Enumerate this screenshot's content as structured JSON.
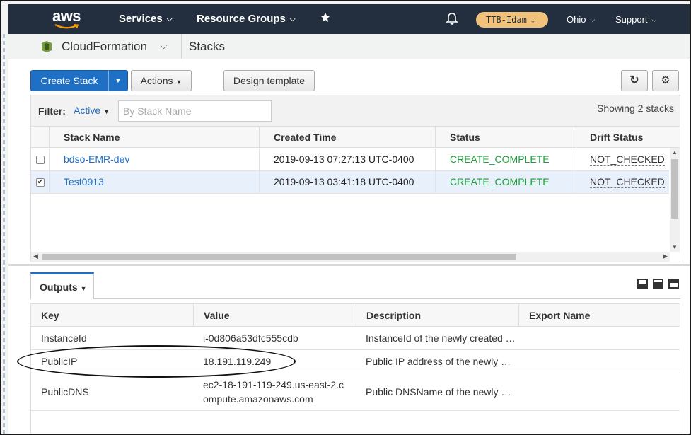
{
  "topnav": {
    "logo_text": "aws",
    "services": "Services",
    "resource_groups": "Resource Groups",
    "account": "TTB-Idam",
    "region": "Ohio",
    "support": "Support"
  },
  "service_bar": {
    "service_name": "CloudFormation",
    "page_title": "Stacks"
  },
  "toolbar": {
    "create_stack": "Create Stack",
    "actions": "Actions",
    "design_template": "Design template",
    "refresh_icon": "↻",
    "settings_icon": "⚙"
  },
  "filter": {
    "label": "Filter:",
    "active": "Active",
    "placeholder": "By Stack Name",
    "showing": "Showing 2 stacks"
  },
  "stacks": {
    "columns": [
      "Stack Name",
      "Created Time",
      "Status",
      "Drift Status"
    ],
    "rows": [
      {
        "name": "bdso-EMR-dev",
        "created": "2019-09-13 07:27:13 UTC-0400",
        "status": "CREATE_COMPLETE",
        "drift": "NOT_CHECKED",
        "checked": false
      },
      {
        "name": "Test0913",
        "created": "2019-09-13 03:41:18 UTC-0400",
        "status": "CREATE_COMPLETE",
        "drift": "NOT_CHECKED",
        "checked": true
      }
    ]
  },
  "outputs": {
    "tab_label": "Outputs",
    "columns": [
      "Key",
      "Value",
      "Description",
      "Export Name"
    ],
    "rows": [
      {
        "key": "InstanceId",
        "value": "i-0d806a53dfc555cdb",
        "description": "InstanceId of the newly created …",
        "export": ""
      },
      {
        "key": "PublicIP",
        "value": "18.191.119.249",
        "description": "Public IP address of the newly …",
        "export": ""
      },
      {
        "key": "PublicDNS",
        "value": "ec2-18-191-119-249.us-east-2.compute.amazonaws.com",
        "description": "Public DNSName of the newly …",
        "export": ""
      }
    ]
  },
  "colors": {
    "nav_bg": "#232f3e",
    "primary": "#1f6fc5",
    "status_ok": "#1e9d3a",
    "account_badge": "#f0c27b"
  }
}
